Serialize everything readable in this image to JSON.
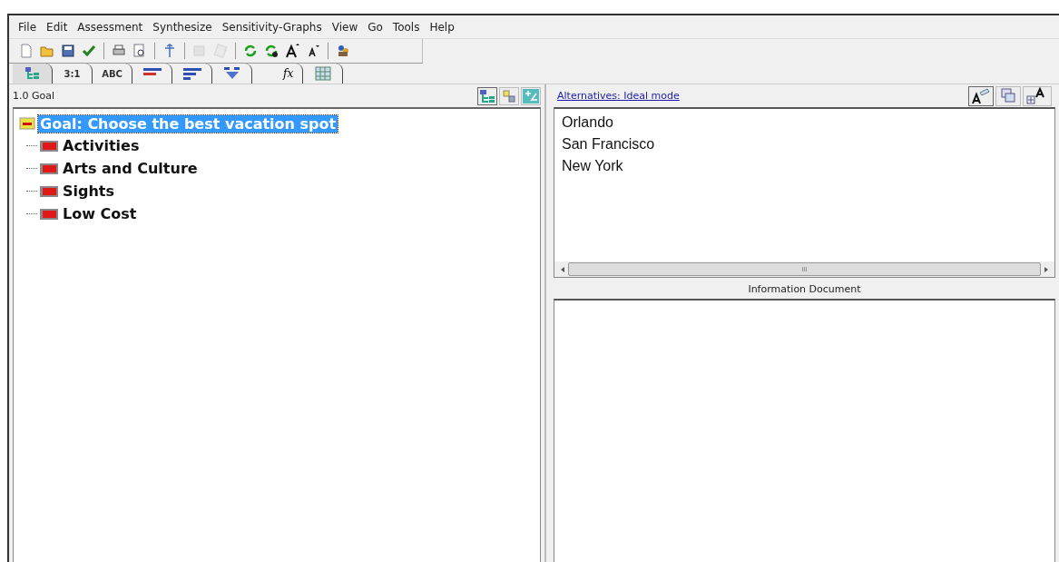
{
  "menu": [
    "File",
    "Edit",
    "Assessment",
    "Synthesize",
    "Sensitivity-Graphs",
    "View",
    "Go",
    "Tools",
    "Help"
  ],
  "toolbar": [
    {
      "kind": "new",
      "disabled": false
    },
    {
      "kind": "open",
      "disabled": false
    },
    {
      "kind": "save",
      "disabled": false
    },
    {
      "kind": "check",
      "disabled": false
    },
    {
      "kind": "sep"
    },
    {
      "kind": "print",
      "disabled": false
    },
    {
      "kind": "preview",
      "disabled": false
    },
    {
      "kind": "sep"
    },
    {
      "kind": "move",
      "disabled": false
    },
    {
      "kind": "sep"
    },
    {
      "kind": "edit",
      "disabled": true
    },
    {
      "kind": "paste",
      "disabled": true
    },
    {
      "kind": "sep"
    },
    {
      "kind": "cycle",
      "disabled": false
    },
    {
      "kind": "cycle2",
      "disabled": false
    },
    {
      "kind": "fontup",
      "disabled": false
    },
    {
      "kind": "fontdown",
      "disabled": false
    },
    {
      "kind": "sep"
    },
    {
      "kind": "users",
      "disabled": false
    }
  ],
  "tabs": [
    {
      "kind": "tree",
      "selected": true
    },
    {
      "kind": "text",
      "label": "3:1",
      "selected": false
    },
    {
      "kind": "text",
      "label": "ABC",
      "selected": false
    },
    {
      "kind": "bars",
      "selected": false
    },
    {
      "kind": "bars2",
      "selected": false
    },
    {
      "kind": "funnel",
      "selected": false
    },
    {
      "kind": "formula",
      "label": "fx",
      "selected": false
    },
    {
      "kind": "grid",
      "selected": false
    }
  ],
  "model_panel": {
    "title": "1.0 Goal",
    "tree": [
      {
        "label": "Goal: Choose the best vacation spot",
        "expanded": true,
        "selected": true,
        "children": [
          {
            "label": "Activities",
            "selected": false
          },
          {
            "label": "Arts and Culture",
            "selected": false
          },
          {
            "label": "Sights",
            "selected": false
          },
          {
            "label": "Low Cost",
            "selected": false
          }
        ]
      }
    ]
  },
  "alternatives_panel": {
    "title": "Alternatives: Ideal mode",
    "alternatives": [
      "Orlando",
      "San Francisco",
      "New York"
    ],
    "scrollbar_grip": "III"
  },
  "information_document": {
    "title": "Information Document"
  }
}
